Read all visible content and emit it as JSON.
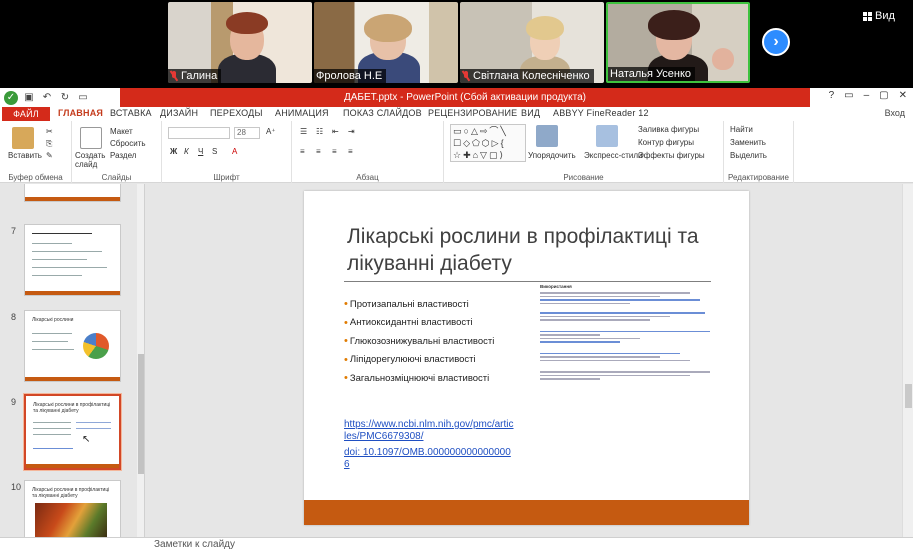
{
  "participants": [
    {
      "name": "Галина",
      "muted": true
    },
    {
      "name": "Фролова Н.Е",
      "muted": false
    },
    {
      "name": "Світлана Колесніченко",
      "muted": true
    },
    {
      "name": "Наталья Усенко",
      "muted": false
    }
  ],
  "view_label": "Вид",
  "powerpoint": {
    "title": "ДАБЕТ.pptx - PowerPoint (Сбой активации продукта)",
    "tabs": [
      "ФАЙЛ",
      "ГЛАВНАЯ",
      "ВСТАВКА",
      "ДИЗАЙН",
      "ПЕРЕХОДЫ",
      "АНИМАЦИЯ",
      "ПОКАЗ СЛАЙДОВ",
      "РЕЦЕНЗИРОВАНИЕ",
      "ВИД",
      "ABBYY FineReader 12"
    ],
    "sign_in": "Вход",
    "ribbon": {
      "paste": "Вставить",
      "new_slide": "Создать слайд",
      "layout": "Макет",
      "reset": "Сбросить",
      "section": "Раздел",
      "font_size": "28",
      "arrange": "Упорядочить",
      "quick_styles": "Экспресс-стили",
      "shape_fill": "Заливка фигуры",
      "shape_outline": "Контур фигуры",
      "shape_effects": "Эффекты фигуры",
      "find": "Найти",
      "replace": "Заменить",
      "select": "Выделить",
      "groups": {
        "clipboard": "Буфер обмена",
        "slides": "Слайды",
        "font": "Шрифт",
        "paragraph": "Абзац",
        "drawing": "Рисование",
        "editing": "Редактирование"
      }
    },
    "thumbnails": [
      {
        "number": "7"
      },
      {
        "number": "8",
        "title": "Лікарські рослини"
      },
      {
        "number": "9",
        "title": "Лікарські рослини в профілактиці та лікуванні діабету",
        "selected": true
      },
      {
        "number": "10",
        "title": "Лікарські рослини в профілактиці та лікуванні діабету"
      }
    ],
    "slide": {
      "title": "Лікарські рослини в профілактиці та лікуванні діабету",
      "bullets": [
        "Протизапальні властивості",
        "Антиоксидантні властивості",
        "Глюкозознижувальні властивості",
        "Ліпідорегулюючі властивості",
        "Загальнозміцнюючі властивості"
      ],
      "refs_title": "Використання",
      "link_1": "https://www.ncbi.nlm.nih.gov/pmc/articles/PMC6679308/",
      "link_2": "doi: 10.1097/OMB.0000000000000006"
    },
    "notes_placeholder": "Заметки к слайду"
  },
  "colors": {
    "accent": "#d24726",
    "title_bar": "#d42a1a",
    "slide_bar": "#c55a11",
    "zoom_blue": "#2d8cff"
  }
}
